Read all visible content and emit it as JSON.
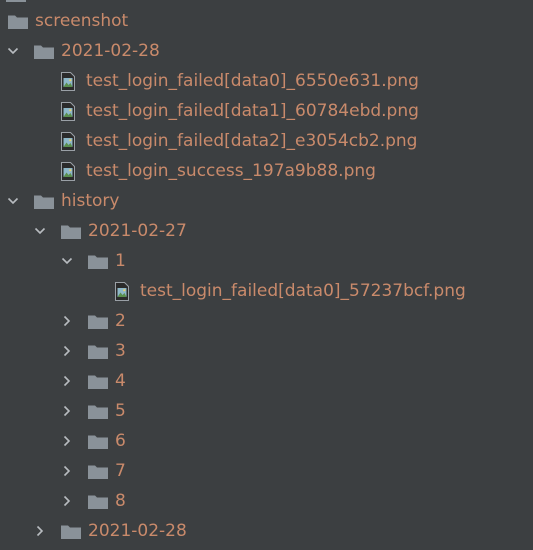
{
  "tree": [
    {
      "label": "screenshot",
      "level": 0,
      "kind": "folder",
      "expanded": null
    },
    {
      "label": "2021-02-28",
      "level": 0,
      "kind": "folder",
      "expanded": true
    },
    {
      "label": "test_login_failed[data0]_6550e631.png",
      "level": 1,
      "kind": "file",
      "expanded": null
    },
    {
      "label": "test_login_failed[data1]_60784ebd.png",
      "level": 1,
      "kind": "file",
      "expanded": null
    },
    {
      "label": "test_login_failed[data2]_e3054cb2.png",
      "level": 1,
      "kind": "file",
      "expanded": null
    },
    {
      "label": "test_login_success_197a9b88.png",
      "level": 1,
      "kind": "file",
      "expanded": null
    },
    {
      "label": "history",
      "level": 0,
      "kind": "folder",
      "expanded": true
    },
    {
      "label": "2021-02-27",
      "level": 1,
      "kind": "folder",
      "expanded": true
    },
    {
      "label": "1",
      "level": 2,
      "kind": "folder",
      "expanded": true
    },
    {
      "label": "test_login_failed[data0]_57237bcf.png",
      "level": 3,
      "kind": "file",
      "expanded": null
    },
    {
      "label": "2",
      "level": 2,
      "kind": "folder",
      "expanded": false
    },
    {
      "label": "3",
      "level": 2,
      "kind": "folder",
      "expanded": false
    },
    {
      "label": "4",
      "level": 2,
      "kind": "folder",
      "expanded": false
    },
    {
      "label": "5",
      "level": 2,
      "kind": "folder",
      "expanded": false
    },
    {
      "label": "6",
      "level": 2,
      "kind": "folder",
      "expanded": false
    },
    {
      "label": "7",
      "level": 2,
      "kind": "folder",
      "expanded": false
    },
    {
      "label": "8",
      "level": 2,
      "kind": "folder",
      "expanded": false
    },
    {
      "label": "2021-02-28",
      "level": 1,
      "kind": "folder",
      "expanded": false
    }
  ],
  "colors": {
    "background": "#3c3f41",
    "text": "#c98a6b",
    "folder": "#8a9299",
    "chevron": "#b8bcc0"
  }
}
